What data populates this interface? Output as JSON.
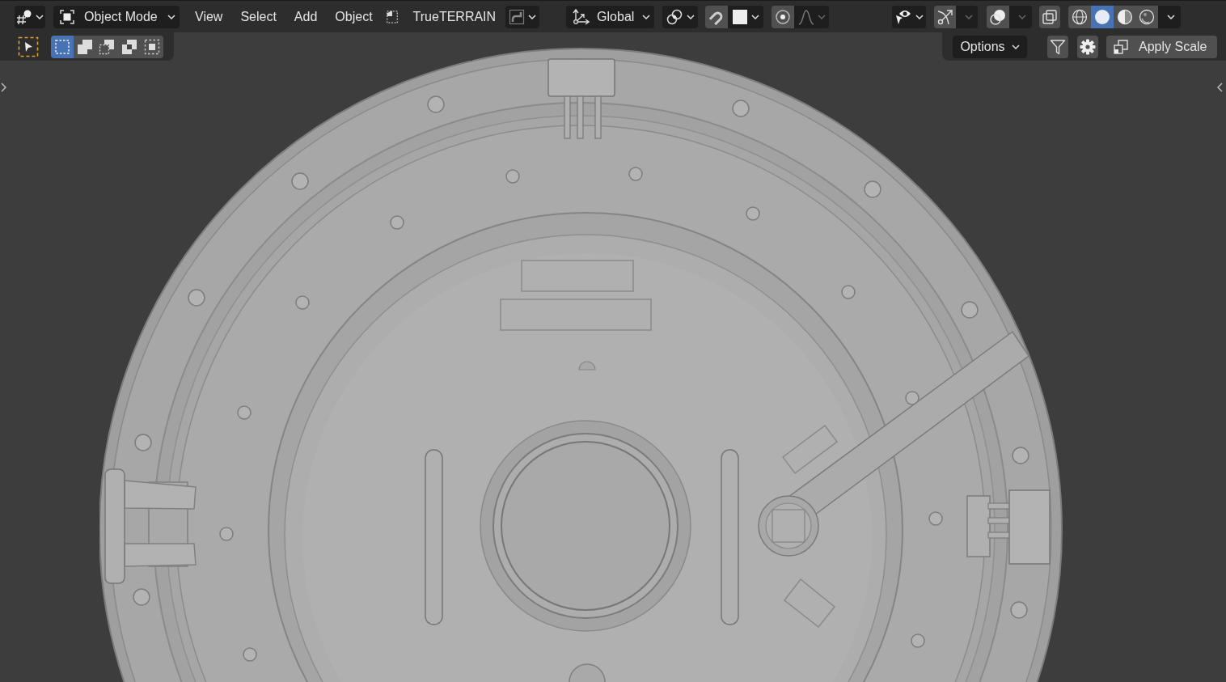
{
  "header": {
    "mode_dropdown": {
      "label": "Object Mode"
    },
    "menus": [
      "View",
      "Select",
      "Add",
      "Object"
    ],
    "addon_menu": {
      "label": "TrueTERRAIN"
    },
    "orientation_dropdown": {
      "label": "Global"
    },
    "shading_modes": [
      {
        "kind": "wireframe",
        "selected": false
      },
      {
        "kind": "solid",
        "selected": true
      },
      {
        "kind": "material",
        "selected": false
      },
      {
        "kind": "rendered",
        "selected": false
      }
    ]
  },
  "tool_settings": {
    "select_modes": [
      {
        "kind": "set",
        "selected": true
      },
      {
        "kind": "extend",
        "selected": false
      },
      {
        "kind": "subtract",
        "selected": false
      },
      {
        "kind": "difference",
        "selected": false
      },
      {
        "kind": "intersect",
        "selected": false
      }
    ],
    "options_dropdown": {
      "label": "Options"
    },
    "apply_scale_button": {
      "label": "Apply Scale"
    }
  }
}
